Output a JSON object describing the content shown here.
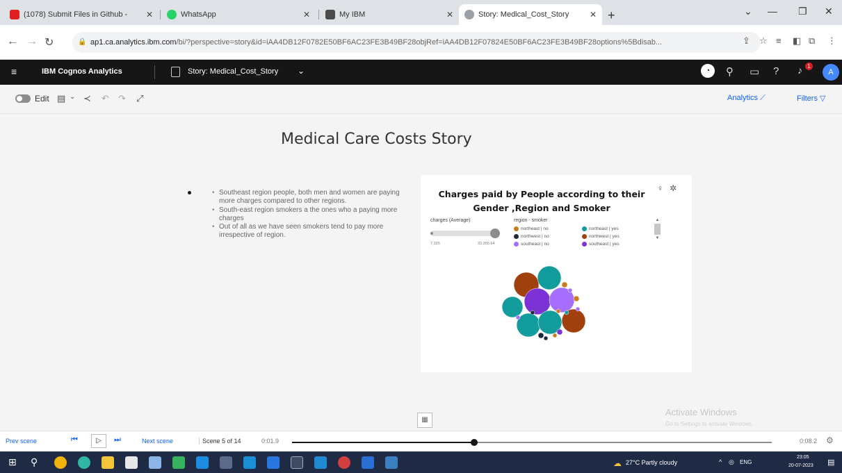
{
  "browser": {
    "tabs": [
      {
        "title": "(1078) Submit Files in Github - ",
        "favicon_color": "#e02020"
      },
      {
        "title": "WhatsApp",
        "favicon_color": "#25d366"
      },
      {
        "title": "My IBM",
        "favicon_color": "#4b4b4b"
      },
      {
        "title": "Story: Medical_Cost_Story",
        "favicon_color": "#9aa0a6",
        "active": true
      }
    ],
    "url_host": "ap1.ca.analytics.ibm.com",
    "url_path": "/bi/?perspective=story&id=iAA4DB12F0782E50BF6AC23FE3B49BF28objRef=iAA4DB12F07824E50BF6AC23FE3B49BF28options%5Bdisab..."
  },
  "app": {
    "brand": "IBM Cognos Analytics",
    "story_title": "Story: Medical_Cost_Story",
    "notification_count": "1",
    "avatar_initial": "A"
  },
  "toolbar": {
    "edit_label": "Edit",
    "analytics_label": "Analytics",
    "filters_label": "Filters"
  },
  "story": {
    "title": "Medical Care Costs Story",
    "notes": [
      "Southeast region people, both men and women are paying more charges compared to other regions.",
      "South-east region smokers a the ones who a paying more charges",
      "Out of all as we have seen smokers tend to pay more irrespective of region."
    ]
  },
  "viz": {
    "title": "Charges paid by People according to their Gender ,Region and Smoker",
    "size_legend_label": "charges (Average)",
    "size_min": "7,325",
    "size_max": "33,355.64",
    "color_legend_label": "region - smoker",
    "legend": [
      {
        "label": "northeast | no",
        "color": "#c97a1a"
      },
      {
        "label": "northeast | yes",
        "color": "#129c9c"
      },
      {
        "label": "northwest | no",
        "color": "#1c2b3c"
      },
      {
        "label": "northwest | yes",
        "color": "#a0410d"
      },
      {
        "label": "southeast | no",
        "color": "#a56eff"
      },
      {
        "label": "southeast | yes",
        "color": "#7c33d6"
      }
    ],
    "chart_data": {
      "type": "scatter",
      "encoding": "packed-bubble",
      "size_measure": "charges (Average)",
      "color_dimension": "region - smoker",
      "size_range": [
        7325,
        33355.64
      ]
    }
  },
  "playback": {
    "prev_label": "Prev scene",
    "next_label": "Next scene",
    "scene_label": "Scene 5 of 14",
    "current_time": "0:01.9",
    "total_time": "0:08.2",
    "progress": 0.38
  },
  "watermark": {
    "title": "Activate Windows",
    "subtitle": "Go to Settings to activate Windows."
  },
  "taskbar": {
    "weather": "27°C  Partly cloudy",
    "lang": "ENG",
    "time": "23:05",
    "date": "20-07-2023"
  }
}
